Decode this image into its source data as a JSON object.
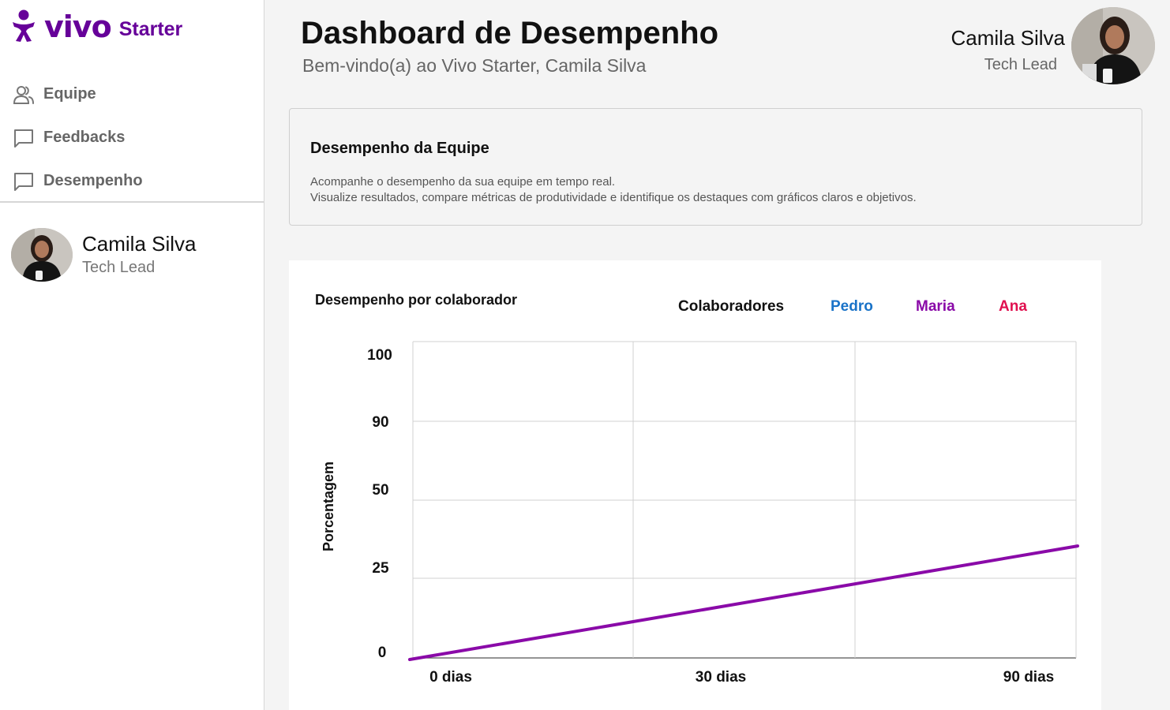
{
  "brand": {
    "name": "vivo",
    "product": "Starter",
    "color": "#660099",
    "icon": "vivo-logo-icon"
  },
  "sidebar": {
    "items": [
      {
        "label": "Equipe",
        "icon": "users-icon"
      },
      {
        "label": "Feedbacks",
        "icon": "chat-icon"
      },
      {
        "label": "Desempenho",
        "icon": "chat-icon"
      }
    ],
    "profile": {
      "name": "Camila Silva",
      "role": "Tech Lead"
    }
  },
  "header": {
    "title": "Dashboard de Desempenho",
    "subtitle": "Bem-vindo(a) ao Vivo Starter, Camila Silva",
    "user": {
      "name": "Camila Silva",
      "role": "Tech Lead"
    }
  },
  "info_card": {
    "title": "Desempenho da Equipe",
    "line1": "Acompanhe o desempenho da sua equipe em tempo real.",
    "line2": "Visualize resultados, compare métricas de produtividade e identifique os destaques com gráficos claros e objetivos."
  },
  "chart_data": {
    "type": "line",
    "title": "Desempenho por colaborador",
    "xlabel": "",
    "ylabel": "Porcentagem",
    "categories": [
      "0 dias",
      "30 dias",
      "90 dias"
    ],
    "y_ticks": [
      "100",
      "90",
      "50",
      "25",
      "0"
    ],
    "legend": {
      "title": "Colaboradores",
      "placement": "top-right",
      "entries": [
        {
          "name": "Pedro",
          "color": "#1a73c8"
        },
        {
          "name": "Maria",
          "color": "#8a0aa8"
        },
        {
          "name": "Ana",
          "color": "#e0104f"
        }
      ]
    },
    "grid": true,
    "series": [
      {
        "name": "Maria",
        "color": "#8a0aa8",
        "values": [
          0,
          14,
          42
        ]
      }
    ]
  }
}
